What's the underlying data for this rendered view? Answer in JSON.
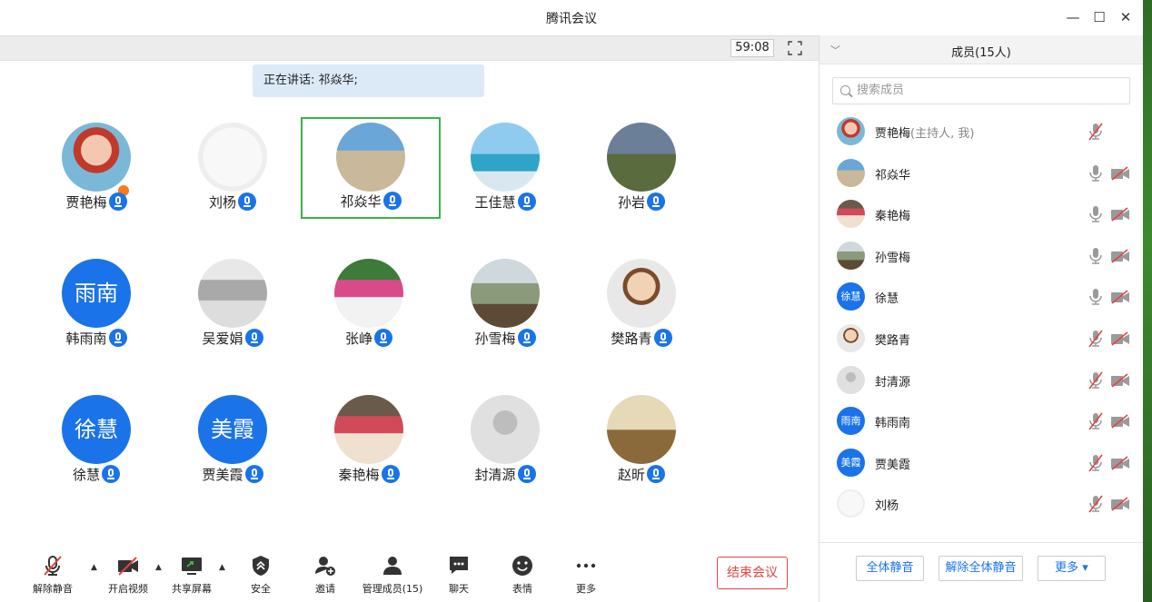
{
  "window": {
    "title": "腾讯会议"
  },
  "timer": "59:08",
  "speaking": "正在讲话: 祁焱华;",
  "participants": [
    {
      "name": "贾艳梅",
      "avatar": "photo",
      "host": true
    },
    {
      "name": "刘杨",
      "avatar": "photo"
    },
    {
      "name": "祁焱华",
      "avatar": "photo",
      "active": true
    },
    {
      "name": "王佳慧",
      "avatar": "photo"
    },
    {
      "name": "孙岩",
      "avatar": "photo"
    },
    {
      "name": "韩雨南",
      "avatar": "text",
      "avatar_text": "雨南"
    },
    {
      "name": "吴爱娟",
      "avatar": "photo"
    },
    {
      "name": "张峥",
      "avatar": "photo"
    },
    {
      "name": "孙雪梅",
      "avatar": "photo"
    },
    {
      "name": "樊路青",
      "avatar": "photo"
    },
    {
      "name": "徐慧",
      "avatar": "text",
      "avatar_text": "徐慧"
    },
    {
      "name": "贾美霞",
      "avatar": "text",
      "avatar_text": "美霞"
    },
    {
      "name": "秦艳梅",
      "avatar": "photo"
    },
    {
      "name": "封清源",
      "avatar": "placeholder"
    },
    {
      "name": "赵昕",
      "avatar": "photo"
    }
  ],
  "toolbar": {
    "unmute": "解除静音",
    "video": "开启视频",
    "share": "共享屏幕",
    "security": "安全",
    "invite": "邀请",
    "manage": "管理成员(15)",
    "chat": "聊天",
    "reaction": "表情",
    "more": "更多",
    "end": "结束会议"
  },
  "panel": {
    "title": "成员(15人)",
    "search_placeholder": "搜索成员",
    "members": [
      {
        "name": "贾艳梅",
        "role": "(主持人, 我)",
        "avatar": "photo",
        "mic": "muted",
        "cam": "none"
      },
      {
        "name": "祁焱华",
        "role": "",
        "avatar": "photo",
        "mic": "on",
        "cam": "off"
      },
      {
        "name": "秦艳梅",
        "role": "",
        "avatar": "photo",
        "mic": "on",
        "cam": "off"
      },
      {
        "name": "孙雪梅",
        "role": "",
        "avatar": "photo",
        "mic": "on",
        "cam": "off"
      },
      {
        "name": "徐慧",
        "role": "",
        "avatar": "text",
        "avatar_text": "徐慧",
        "mic": "on",
        "cam": "off"
      },
      {
        "name": "樊路青",
        "role": "",
        "avatar": "photo",
        "mic": "muted",
        "cam": "off"
      },
      {
        "name": "封清源",
        "role": "",
        "avatar": "placeholder",
        "mic": "muted",
        "cam": "off"
      },
      {
        "name": "韩雨南",
        "role": "",
        "avatar": "text",
        "avatar_text": "雨南",
        "mic": "muted",
        "cam": "off"
      },
      {
        "name": "贾美霞",
        "role": "",
        "avatar": "text",
        "avatar_text": "美霞",
        "mic": "muted",
        "cam": "off"
      },
      {
        "name": "刘杨",
        "role": "",
        "avatar": "photo",
        "mic": "muted",
        "cam": "off"
      }
    ],
    "mute_all": "全体静音",
    "unmute_all": "解除全体静音",
    "more": "更多"
  },
  "colors": {
    "accent": "#1a73e8",
    "active_border": "#3ab44a",
    "end_red": "#e04444"
  }
}
